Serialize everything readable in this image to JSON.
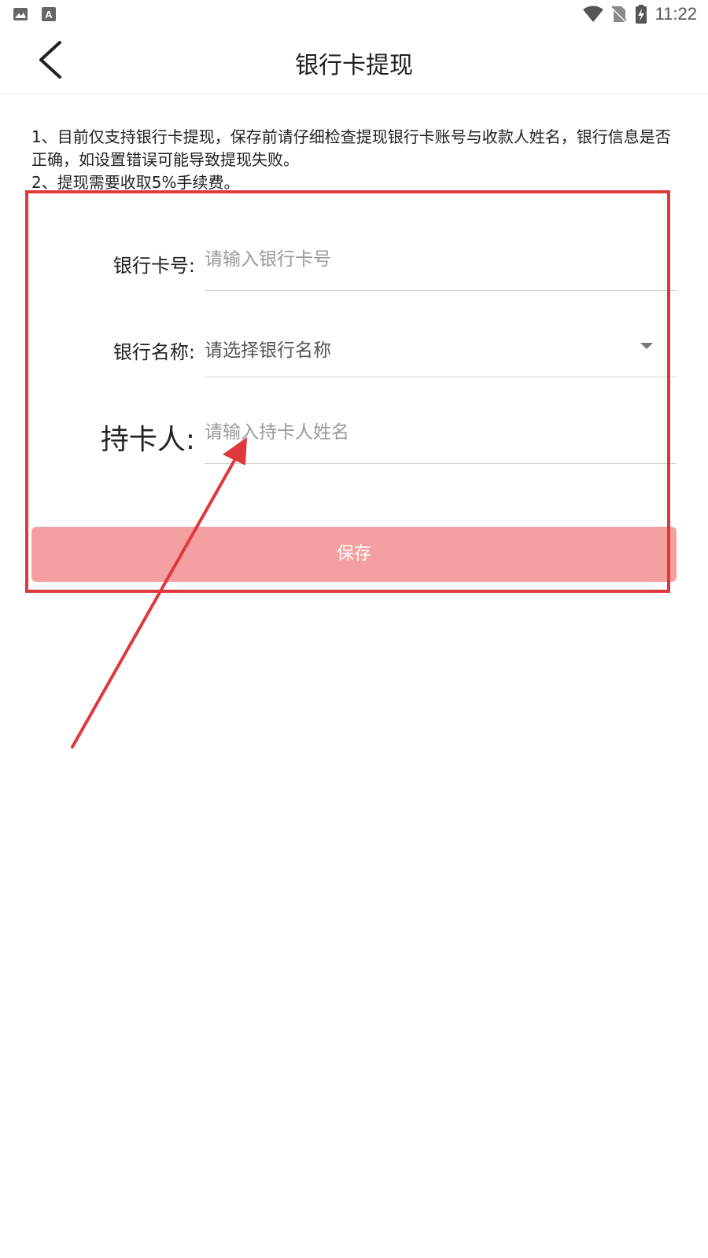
{
  "status_bar": {
    "time": "11:22",
    "left_icons": [
      "image-icon",
      "text-a-icon"
    ],
    "right_icons": [
      "wifi-icon",
      "no-sim-icon",
      "battery-charging-icon"
    ]
  },
  "header": {
    "title": "银行卡提现",
    "back_icon": "back-chevron-icon"
  },
  "notice": {
    "line1": "1、目前仅支持银行卡提现，保存前请仔细检查提现银行卡账号与收款人姓名，银行信息是否正确，如设置错误可能导致提现失败。",
    "line2": "2、提现需要收取5%手续费。"
  },
  "form": {
    "card_number": {
      "label": "银行卡号:",
      "placeholder": "请输入银行卡号",
      "value": ""
    },
    "bank_name": {
      "label": "银行名称:",
      "selected": "请选择银行名称"
    },
    "card_holder": {
      "label": "持卡人:",
      "placeholder": "请输入持卡人姓名",
      "value": ""
    },
    "save_label": "保存"
  },
  "annotation": {
    "color": "#e0393c"
  },
  "colors": {
    "save_button_bg": "#f5a0a0",
    "annotation_red": "#e0393c"
  }
}
